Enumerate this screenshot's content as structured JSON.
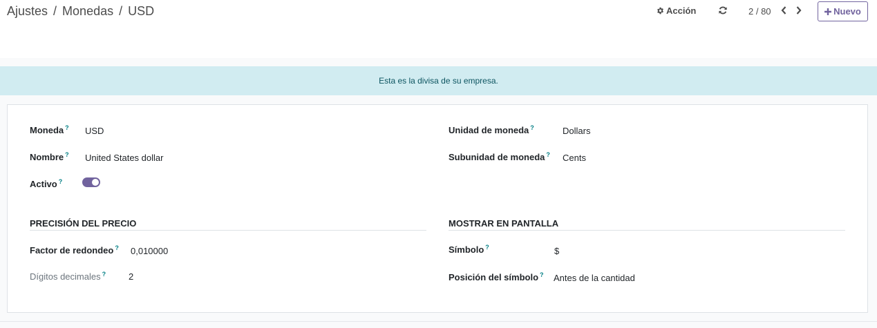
{
  "breadcrumb": {
    "items": [
      "Ajustes",
      "Monedas",
      "USD"
    ],
    "separator": "/"
  },
  "toolbar": {
    "action_label": "Acción",
    "pager": "2 / 80",
    "new_label": "Nuevo"
  },
  "alert": {
    "text": "Esta es la divisa de su empresa."
  },
  "form": {
    "currency": {
      "label": "Moneda",
      "tip": "?",
      "value": "USD"
    },
    "name": {
      "label": "Nombre",
      "tip": "?",
      "value": "United States dollar"
    },
    "active": {
      "label": "Activo",
      "tip": "?",
      "value": true
    },
    "unit": {
      "label": "Unidad de moneda",
      "tip": "?",
      "value": "Dollars"
    },
    "subunit": {
      "label": "Subunidad de moneda",
      "tip": "?",
      "value": "Cents"
    },
    "price_precision": {
      "title": "PRECISIÓN DEL PRECIO",
      "rounding": {
        "label": "Factor de redondeo",
        "tip": "?",
        "value": "0,010000"
      },
      "decimals": {
        "label": "Dígitos decimales",
        "tip": "?",
        "value": "2"
      }
    },
    "display": {
      "title": "MOSTRAR EN PANTALLA",
      "symbol": {
        "label": "Símbolo",
        "tip": "?",
        "value": "$"
      },
      "position": {
        "label": "Posición del símbolo",
        "tip": "?",
        "value": "Antes de la cantidad"
      }
    }
  },
  "colors": {
    "accent": "#71639e",
    "alert_bg": "#d1ecf1",
    "alert_text": "#0c5460",
    "tooltip": "#017e84"
  }
}
